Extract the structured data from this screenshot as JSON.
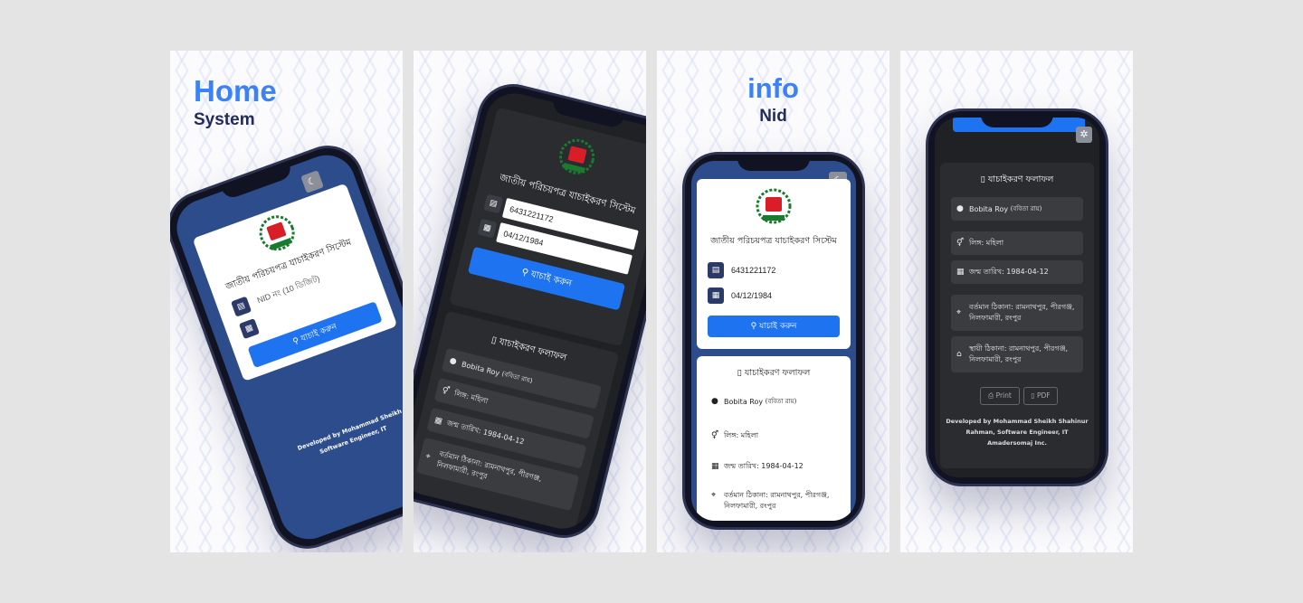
{
  "panels": [
    {
      "heading_big": "Home",
      "heading_small": "System"
    },
    {
      "heading_big": "",
      "heading_small": ""
    },
    {
      "heading_big": "info",
      "heading_small": "Nid"
    },
    {
      "heading_big": "",
      "heading_small": ""
    }
  ],
  "app": {
    "title_bn": "জাতীয় পরিচয়পত্র যাচাইকরণ সিস্টেম",
    "nid_placeholder": "NID নং (10 ডিজিট)",
    "nid_value": "6431221172",
    "dob_value": "04/12/1984",
    "search_label": "যাচাই করুন",
    "result_title": "যাচাইকরণ ফলাফল",
    "name": "Bobita Roy",
    "name_bn": "(ববিতা রায়)",
    "gender": "লিঙ্গ: মহিলা",
    "dob_line": "জন্ম তারিখ: 1984-04-12",
    "present_address": "বর্তমান ঠিকানা: রামনাথপুর, পীরগঞ্জ, নিলফামারী, রংপুর",
    "permanent_address": "স্থায়ী ঠিকানা: রামনাথপুর, পীরগঞ্জ, নিলফামারী, রংপুর",
    "print_label": "Print",
    "pdf_label": "PDF",
    "footer_1": "Developed by Mohammad Sheikh Shahinur",
    "footer_2": "Rahman, Software Engineer, IT",
    "footer_3": "Amadersomaj Inc.",
    "footer_short_1": "Developed by Mohammad Sheikh",
    "footer_short_2": "Software Engineer, IT"
  },
  "colors": {
    "accent": "#3b82f6",
    "navy": "#232a5c",
    "button_blue": "#1e73f0",
    "frame_blue": "#2c4c8c",
    "dark_bg": "#2a2c30"
  },
  "icons": [
    "moon-icon",
    "gear-icon",
    "id-card-icon",
    "calendar-icon",
    "search-icon",
    "user-icon",
    "gender-icon",
    "map-pin-icon",
    "home-icon",
    "file-icon",
    "printer-icon",
    "pdf-icon"
  ]
}
